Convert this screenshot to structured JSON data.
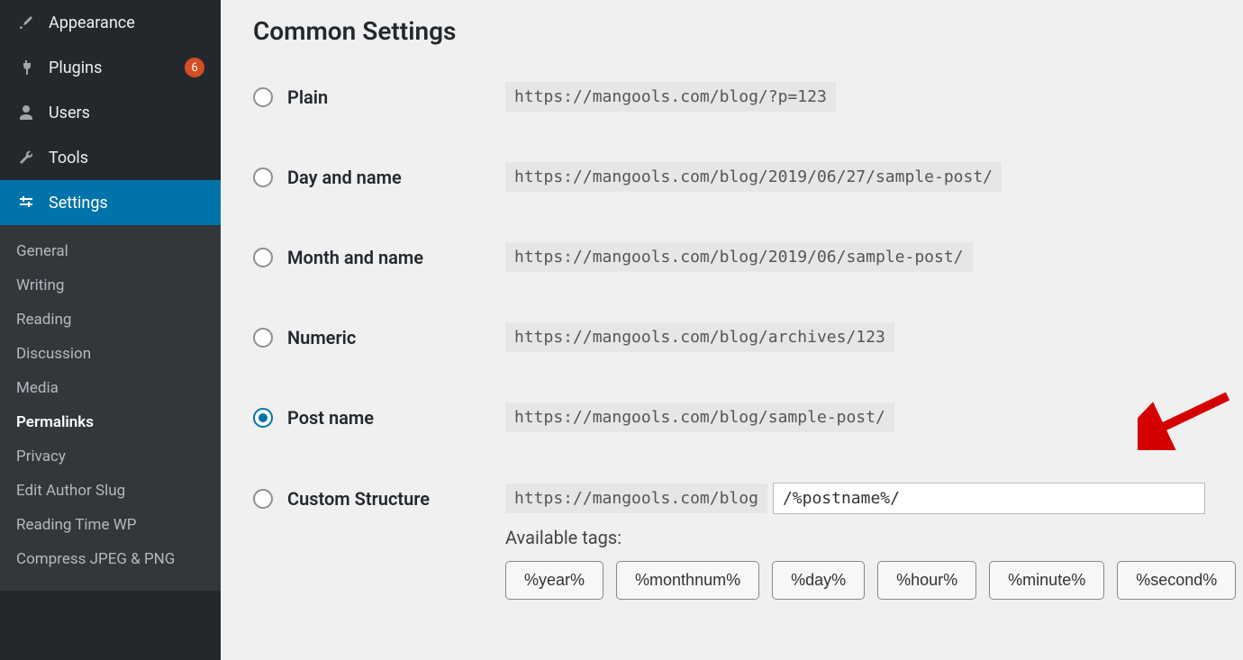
{
  "sidebar": {
    "menu": [
      {
        "label": "Appearance",
        "icon": "brush"
      },
      {
        "label": "Plugins",
        "icon": "plug",
        "badge": "6"
      },
      {
        "label": "Users",
        "icon": "user"
      },
      {
        "label": "Tools",
        "icon": "wrench"
      },
      {
        "label": "Settings",
        "icon": "sliders",
        "active": true
      }
    ],
    "submenu": [
      {
        "label": "General"
      },
      {
        "label": "Writing"
      },
      {
        "label": "Reading"
      },
      {
        "label": "Discussion"
      },
      {
        "label": "Media"
      },
      {
        "label": "Permalinks",
        "current": true
      },
      {
        "label": "Privacy"
      },
      {
        "label": "Edit Author Slug"
      },
      {
        "label": "Reading Time WP"
      },
      {
        "label": "Compress JPEG & PNG"
      }
    ]
  },
  "content": {
    "section_title": "Common Settings",
    "options": [
      {
        "label": "Plain",
        "url": "https://mangools.com/blog/?p=123"
      },
      {
        "label": "Day and name",
        "url": "https://mangools.com/blog/2019/06/27/sample-post/"
      },
      {
        "label": "Month and name",
        "url": "https://mangools.com/blog/2019/06/sample-post/"
      },
      {
        "label": "Numeric",
        "url": "https://mangools.com/blog/archives/123"
      },
      {
        "label": "Post name",
        "url": "https://mangools.com/blog/sample-post/",
        "checked": true
      }
    ],
    "custom": {
      "label": "Custom Structure",
      "prefix": "https://mangools.com/blog",
      "value": "/%postname%/"
    },
    "available_tags_label": "Available tags:",
    "tags": [
      "%year%",
      "%monthnum%",
      "%day%",
      "%hour%",
      "%minute%",
      "%second%"
    ]
  }
}
